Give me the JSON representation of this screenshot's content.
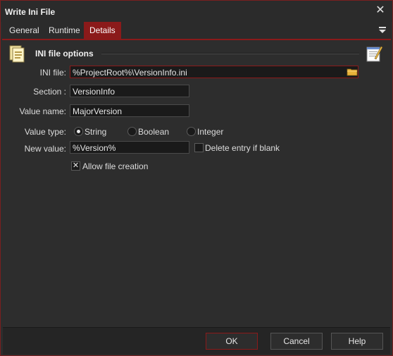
{
  "window": {
    "title": "Write Ini File"
  },
  "tabs": [
    {
      "label": "General",
      "active": false
    },
    {
      "label": "Runtime",
      "active": false
    },
    {
      "label": "Details",
      "active": true
    }
  ],
  "section": {
    "title": "INI file options"
  },
  "fields": {
    "ini_file": {
      "label": "INI file:",
      "value": "%ProjectRoot%\\VersionInfo.ini"
    },
    "section": {
      "label": "Section :",
      "value": "VersionInfo"
    },
    "value_name": {
      "label": "Value name:",
      "value": "MajorVersion"
    },
    "value_type": {
      "label": "Value type:",
      "options": [
        "String",
        "Boolean",
        "Integer"
      ],
      "selected": "String"
    },
    "new_value": {
      "label": "New value:",
      "value": "%Version%"
    },
    "delete_if_blank": {
      "label": "Delete entry if blank",
      "checked": false
    },
    "allow_creation": {
      "label": "Allow file creation",
      "checked": true
    }
  },
  "buttons": {
    "ok": "OK",
    "cancel": "Cancel",
    "help": "Help"
  },
  "colors": {
    "accent": "#8b1a1a",
    "background": "#2d2d2d",
    "input_bg": "#1a1a1a"
  },
  "icons": [
    "close-icon",
    "menu-icon",
    "ini-file-icon",
    "notepad-icon",
    "folder-icon"
  ]
}
